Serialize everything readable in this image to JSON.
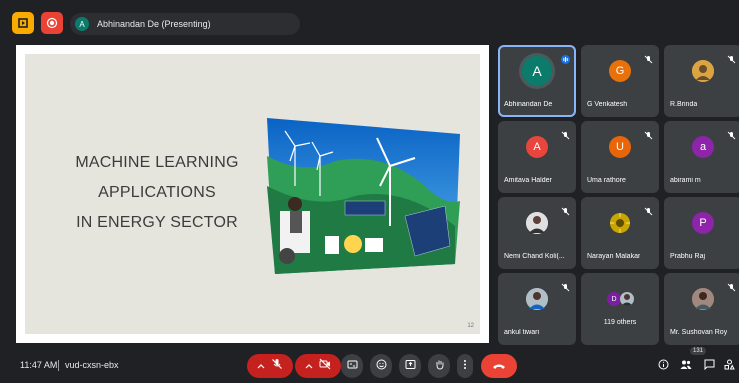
{
  "presenter_chip": {
    "avatar_letter": "A",
    "label": "Abhinandan De (Presenting)"
  },
  "slide": {
    "title_lines": [
      "MACHINE LEARNING",
      "APPLICATIONS",
      "IN ENERGY SECTOR"
    ],
    "page_number": "12"
  },
  "participants": [
    {
      "name": "Abhinandan De",
      "letter": "A",
      "color": "#0b7b6b",
      "speaking": true
    },
    {
      "name": "G Venkatesh",
      "letter": "G",
      "color": "#e8710a"
    },
    {
      "name": "R.Brinda",
      "letter": "",
      "color": "#d9a441",
      "photo": true
    },
    {
      "name": "Amitava Halder",
      "letter": "A",
      "color": "#e8453c"
    },
    {
      "name": "Uma rathore",
      "letter": "U",
      "color": "#e8650a"
    },
    {
      "name": "abirami m",
      "letter": "a",
      "color": "#8e24aa"
    },
    {
      "name": "Nemi Chand Koli(...",
      "letter": "",
      "color": "#d7ccc8",
      "photo": true
    },
    {
      "name": "Narayan Malakar",
      "letter": "",
      "color": "#c8a600",
      "photo": true
    },
    {
      "name": "Prabhu Raj",
      "letter": "P",
      "color": "#8e24aa"
    },
    {
      "name": "ankul tiwari",
      "letter": "",
      "color": "#9aa6b8",
      "photo": true
    },
    {
      "name": "119 others",
      "letter": "D",
      "color": "#7b1fa2"
    },
    {
      "name": "Mr. Sushovan Roy",
      "letter": "",
      "color": "#8d6e63",
      "photo": true
    }
  ],
  "bottom": {
    "time": "11:47 AM",
    "meeting_code": "vud-cxsn-ebx",
    "participant_count": "131"
  },
  "colors": {
    "background": "#202124",
    "tile": "#3c4043",
    "danger": "#ea4335"
  }
}
